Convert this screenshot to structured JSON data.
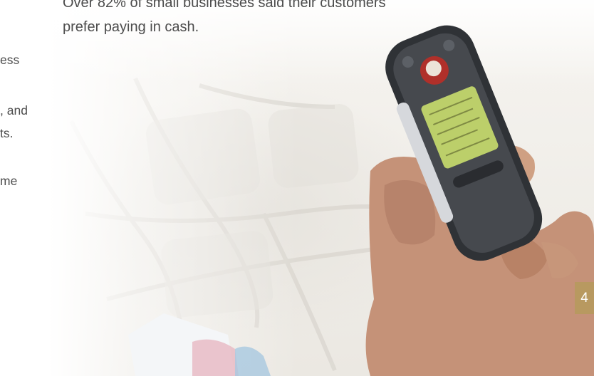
{
  "quote": {
    "line1": "Over 82% of small businesses said their customers",
    "line2": "prefer paying in cash."
  },
  "left_fragments": [
    "ess",
    ", and",
    "ts.",
    "me"
  ],
  "page_number": "4",
  "colors": {
    "accent": "#b89960",
    "text": "#4c4c4c"
  },
  "photo": {
    "subject": "hand-holding-mobile-phone",
    "phone_screen_color": "#bccf6a"
  }
}
